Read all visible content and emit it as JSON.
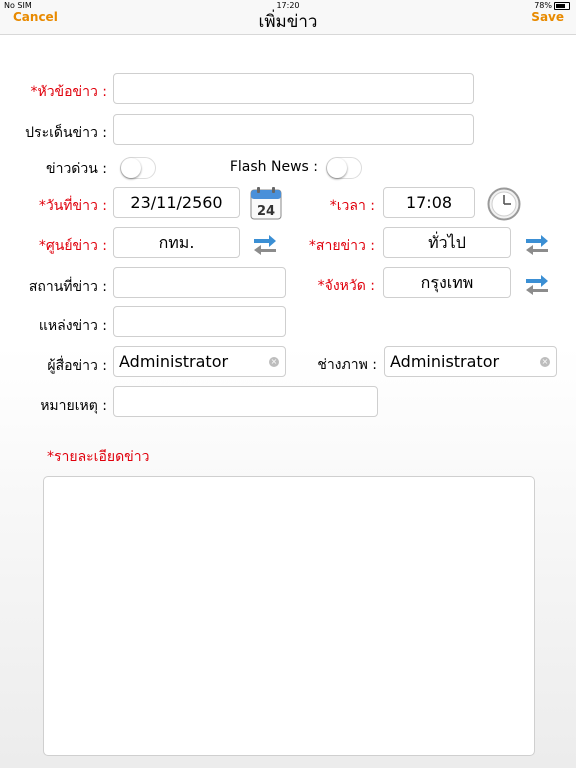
{
  "status": {
    "carrier": "No SIM",
    "time": "17:20",
    "battery": "78%"
  },
  "nav": {
    "cancel": "Cancel",
    "title": "เพิ่มข่าว",
    "save": "Save"
  },
  "form": {
    "headline_label": "*หัวข้อข่าว :",
    "topic_label": "ประเด็นข่าว :",
    "breaking_label": "ข่าวด่วน :",
    "flash_label": "Flash News :",
    "date_label": "*วันที่ข่าว :",
    "date_value": "23/11/2560",
    "calendar_day": "24",
    "time_label": "*เวลา :",
    "time_value": "17:08",
    "center_label": "*ศูนย์ข่าว :",
    "center_value": "กทม.",
    "line_label": "*สายข่าว :",
    "line_value": "ทั่วไป",
    "place_label": "สถานที่ข่าว :",
    "province_label": "*จังหวัด :",
    "province_value": "กรุงเทพ",
    "source_label": "แหล่งข่าว :",
    "reporter_label": "ผู้สื่อข่าว :",
    "reporter_value": "Administrator",
    "photographer_label": "ช่างภาพ :",
    "photographer_value": "Administrator",
    "note_label": "หมายเหตุ :",
    "detail_label": "*รายละเอียดข่าว"
  },
  "colors": {
    "accent": "#e88a00",
    "required": "#e0000c"
  },
  "icons": {
    "calendar": "calendar-icon",
    "clock": "clock-icon",
    "swap": "swap-arrows-icon"
  }
}
